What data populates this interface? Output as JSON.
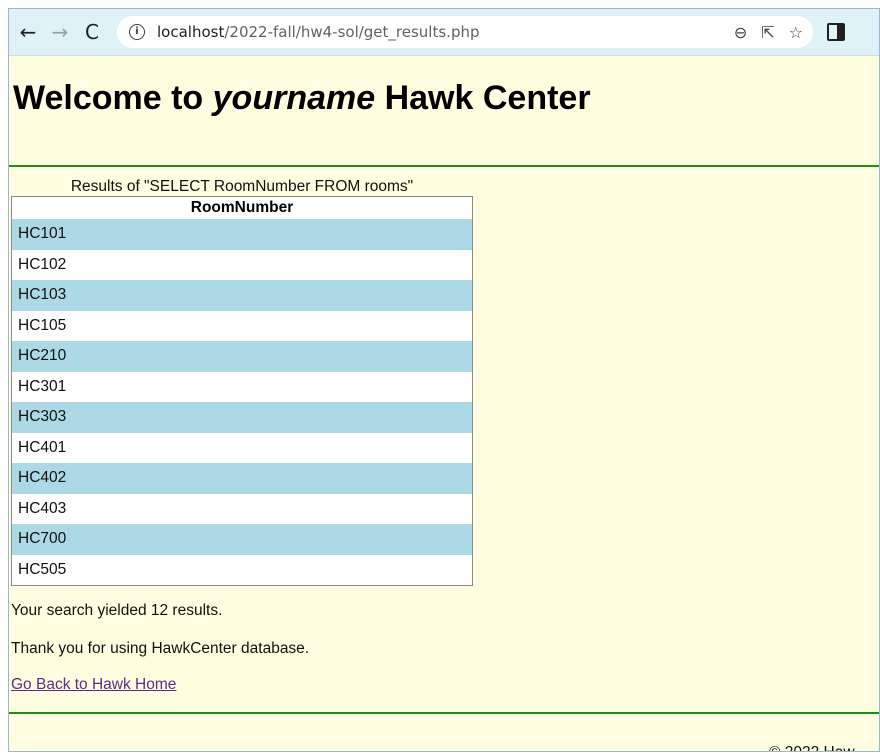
{
  "browser": {
    "url_host": "localhost",
    "url_path": "/2022-fall/hw4-sol/get_results.php",
    "icons": [
      "back-arrow-icon",
      "forward-arrow-icon",
      "reload-icon",
      "info-icon",
      "zoom-icon",
      "share-icon",
      "star-icon",
      "side-panel-icon"
    ]
  },
  "page": {
    "title_prefix": "Welcome to ",
    "title_name": "yourname",
    "title_suffix": " Hawk Center",
    "caption": "Results of \"SELECT RoomNumber FROM rooms\"",
    "table": {
      "header": "RoomNumber",
      "rows": [
        "HC101",
        "HC102",
        "HC103",
        "HC105",
        "HC210",
        "HC301",
        "HC303",
        "HC401",
        "HC402",
        "HC403",
        "HC700",
        "HC505"
      ]
    },
    "result_count_text": "Your search yielded 12 results.",
    "thank_you_text": "Thank you for using HawkCenter database.",
    "back_link": "Go Back to Hawk Home",
    "footer": "© 2022 Haw"
  },
  "colors": {
    "page_bg": "#fffee0",
    "row_highlight": "#add8e6",
    "rule": "#2b8a1a",
    "link": "#5a2d8a"
  }
}
